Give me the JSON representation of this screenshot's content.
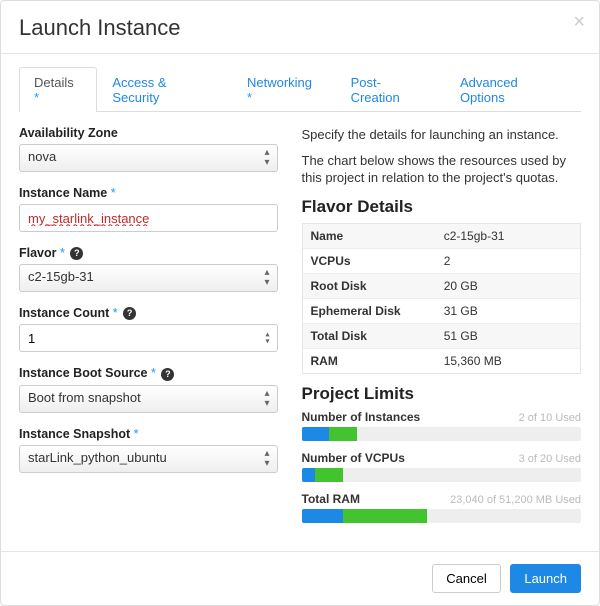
{
  "title": "Launch Instance",
  "tabs": {
    "details": "Details",
    "access": "Access & Security",
    "networking": "Networking",
    "post": "Post-Creation",
    "advanced": "Advanced Options"
  },
  "form": {
    "az": {
      "label": "Availability Zone",
      "value": "nova"
    },
    "name": {
      "label": "Instance Name",
      "value": "my_starlink_instance"
    },
    "flavor": {
      "label": "Flavor",
      "value": "c2-15gb-31"
    },
    "count": {
      "label": "Instance Count",
      "value": "1"
    },
    "boot_src": {
      "label": "Instance Boot Source",
      "value": "Boot from snapshot"
    },
    "snapshot": {
      "label": "Instance Snapshot",
      "value": "starLink_python_ubuntu"
    }
  },
  "right": {
    "desc1": "Specify the details for launching an instance.",
    "desc2": "The chart below shows the resources used by this project in relation to the project's quotas.",
    "flavor_h": "Flavor Details",
    "flavor": {
      "k_name": "Name",
      "v_name": "c2-15gb-31",
      "k_vcpu": "VCPUs",
      "v_vcpu": "2",
      "k_root": "Root Disk",
      "v_root": "20 GB",
      "k_eph": "Ephemeral Disk",
      "v_eph": "31 GB",
      "k_total": "Total Disk",
      "v_total": "51 GB",
      "k_ram": "RAM",
      "v_ram": "15,360 MB"
    },
    "limits_h": "Project Limits",
    "limits": {
      "inst": {
        "name": "Number of Instances",
        "used_text": "2 of 10 Used",
        "cur_pct": 10,
        "new_pct": 10
      },
      "vcpu": {
        "name": "Number of VCPUs",
        "used_text": "3 of 20 Used",
        "cur_pct": 5,
        "new_pct": 10
      },
      "ram": {
        "name": "Total RAM",
        "used_text": "23,040 of 51,200 MB Used",
        "cur_pct": 15,
        "new_pct": 30
      }
    }
  },
  "footer": {
    "cancel": "Cancel",
    "launch": "Launch"
  }
}
